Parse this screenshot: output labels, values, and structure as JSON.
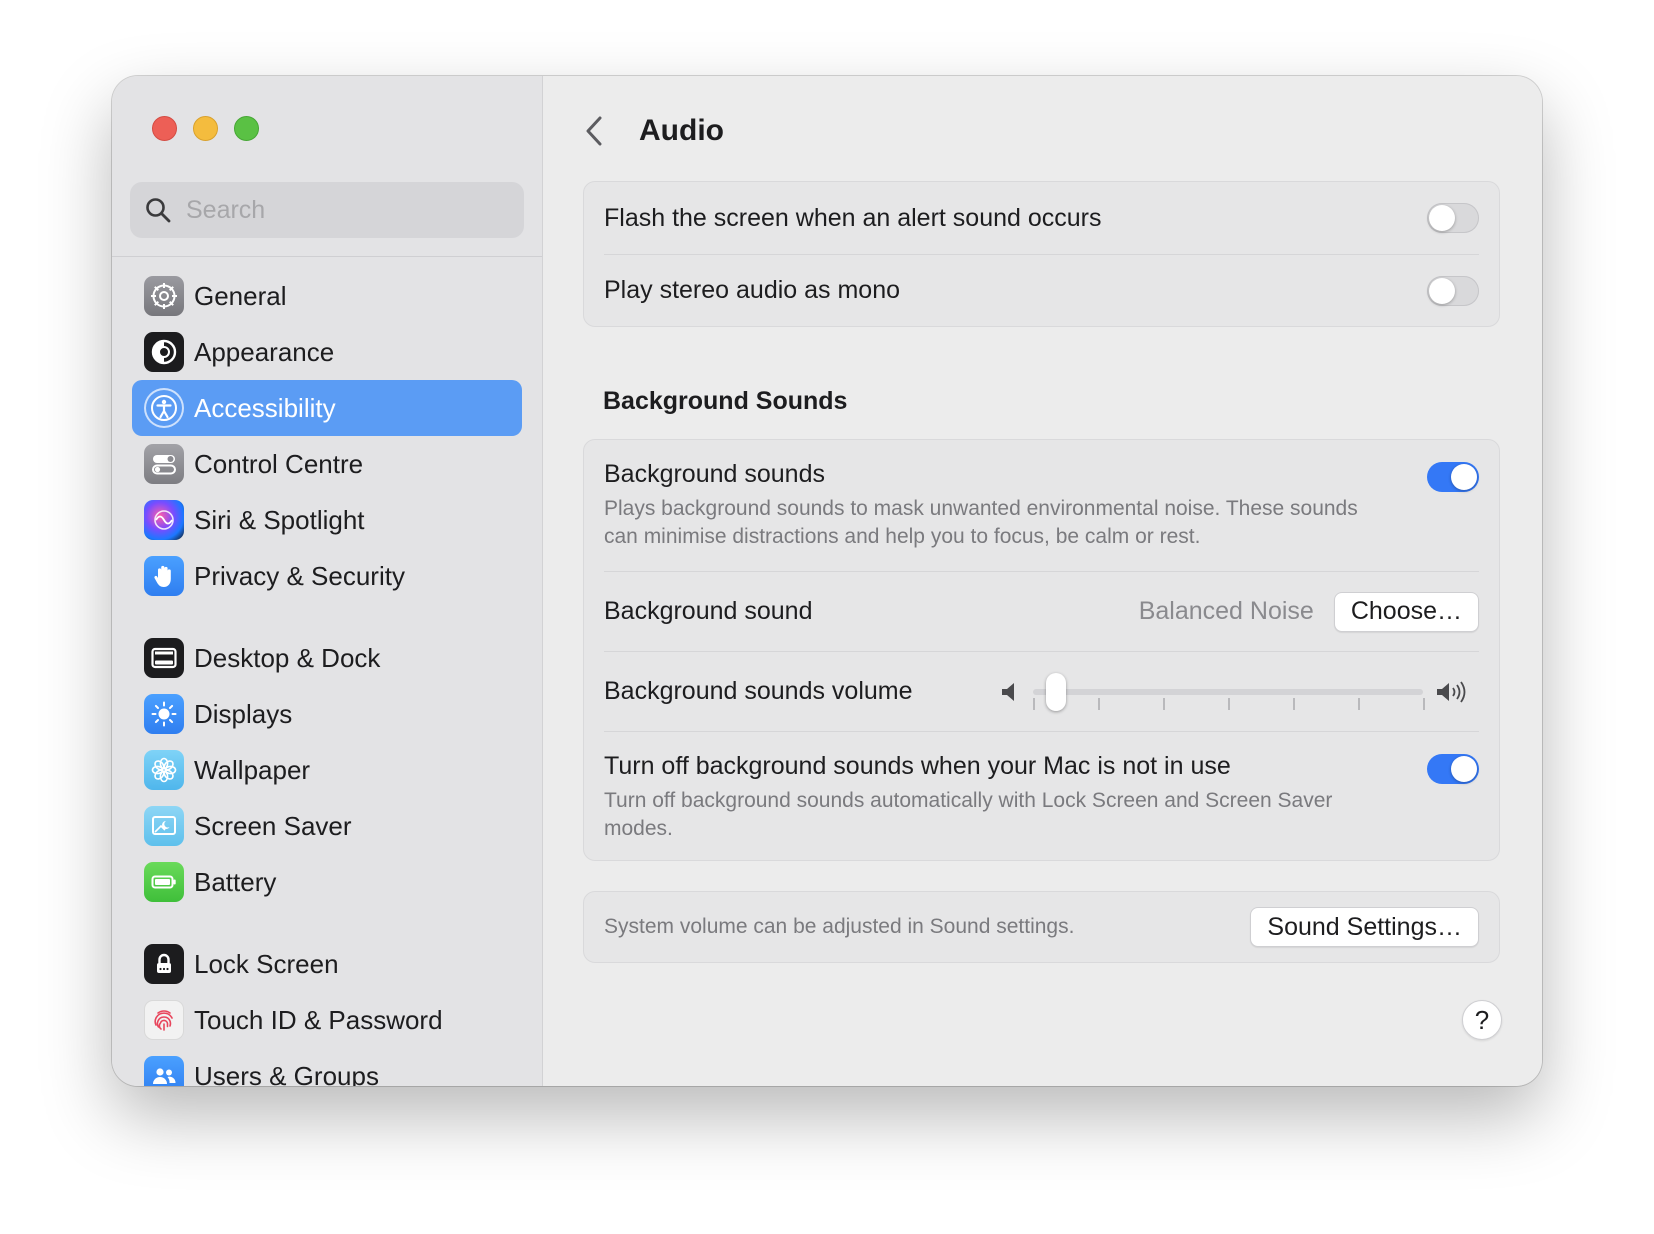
{
  "window": {
    "page_title": "Audio"
  },
  "search": {
    "placeholder": "Search"
  },
  "sidebar": {
    "items": [
      {
        "label": "General",
        "icon": "gear-icon"
      },
      {
        "label": "Appearance",
        "icon": "appearance-icon"
      },
      {
        "label": "Accessibility",
        "icon": "accessibility-icon",
        "selected": true
      },
      {
        "label": "Control Centre",
        "icon": "control-centre-icon"
      },
      {
        "label": "Siri & Spotlight",
        "icon": "siri-icon"
      },
      {
        "label": "Privacy & Security",
        "icon": "hand-icon"
      },
      {
        "label": "Desktop & Dock",
        "icon": "dock-icon"
      },
      {
        "label": "Displays",
        "icon": "sun-icon"
      },
      {
        "label": "Wallpaper",
        "icon": "flower-icon"
      },
      {
        "label": "Screen Saver",
        "icon": "screen-saver-icon"
      },
      {
        "label": "Battery",
        "icon": "battery-icon"
      },
      {
        "label": "Lock Screen",
        "icon": "lock-icon"
      },
      {
        "label": "Touch ID & Password",
        "icon": "fingerprint-icon"
      },
      {
        "label": "Users & Groups",
        "icon": "users-icon"
      }
    ]
  },
  "alerts": {
    "flash_label": "Flash the screen when an alert sound occurs",
    "flash_on": false,
    "mono_label": "Play stereo audio as mono",
    "mono_on": false
  },
  "background_sounds": {
    "section_title": "Background Sounds",
    "toggle_label": "Background sounds",
    "toggle_desc": "Plays background sounds to mask unwanted environmental noise. These sounds can minimise distractions and help you to focus, be calm or rest.",
    "toggle_on": true,
    "sound_label": "Background sound",
    "sound_value": "Balanced Noise",
    "choose_label": "Choose…",
    "volume_label": "Background sounds volume",
    "volume_level": 0.06,
    "turn_off_label": "Turn off background sounds when your Mac is not in use",
    "turn_off_desc": "Turn off background sounds automatically with Lock Screen and Screen Saver modes.",
    "turn_off_on": true
  },
  "sound_settings": {
    "info": "System volume can be adjusted in Sound settings.",
    "button_label": "Sound Settings…"
  },
  "help": {
    "label": "?"
  },
  "colors": {
    "accent": "#3478f6",
    "selection": "#5b9cf4"
  }
}
